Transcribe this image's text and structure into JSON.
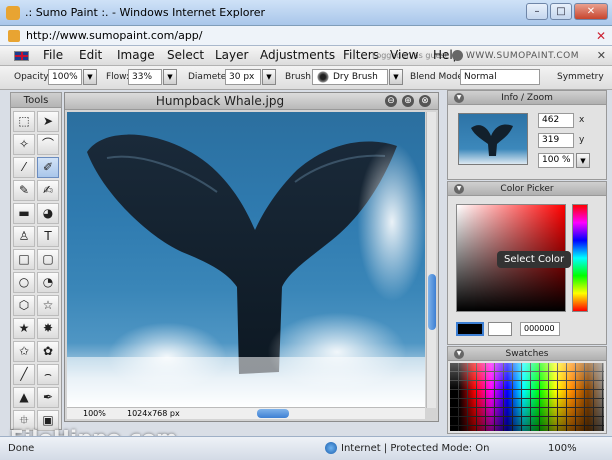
{
  "browser": {
    "title": ".: Sumo Paint       :. - Windows Internet Explorer",
    "address": "http://www.sumopaint.com/app/",
    "window_buttons": [
      "–",
      "□",
      "✕"
    ]
  },
  "menu": {
    "items": [
      "File",
      "Edit",
      "Image",
      "Select",
      "Layer",
      "Adjustments",
      "Filters",
      "View",
      "Help"
    ],
    "logout_text": "Logged in as guest",
    "logo_text": "WWW.SUMOPAINT.COM",
    "close": "✕"
  },
  "options": {
    "opacity_label": "Opacity:",
    "opacity_value": "100%",
    "flow_label": "Flow:",
    "flow_value": "33%",
    "diameter_label": "Diameter:",
    "diameter_value": "30 px",
    "brush_label": "Brush:",
    "brush_value": "Dry Brush",
    "blend_label": "Blend Mode:",
    "blend_value": "Normal",
    "symmetry_label": "Symmetry"
  },
  "tools": {
    "title": "Tools",
    "items": [
      {
        "name": "marquee-tool",
        "glyph": "⬚"
      },
      {
        "name": "move-tool",
        "glyph": "➤"
      },
      {
        "name": "magic-wand-tool",
        "glyph": "✧"
      },
      {
        "name": "lasso-tool",
        "glyph": "⌒"
      },
      {
        "name": "eyedropper-tool",
        "glyph": "⁄"
      },
      {
        "name": "brush-tool",
        "glyph": "✐"
      },
      {
        "name": "pencil-tool",
        "glyph": "✎"
      },
      {
        "name": "smudge-tool",
        "glyph": "✍"
      },
      {
        "name": "eraser-tool",
        "glyph": "▬"
      },
      {
        "name": "fill-tool",
        "glyph": "◕"
      },
      {
        "name": "clone-stamp-tool",
        "glyph": "♙"
      },
      {
        "name": "text-tool",
        "glyph": "T"
      },
      {
        "name": "rectangle-tool",
        "glyph": "□"
      },
      {
        "name": "rounded-rect-tool",
        "glyph": "▢"
      },
      {
        "name": "ellipse-tool",
        "glyph": "○"
      },
      {
        "name": "custom-shape-tool",
        "glyph": "◔"
      },
      {
        "name": "hexagon-tool",
        "glyph": "⬡"
      },
      {
        "name": "star-tool",
        "glyph": "☆"
      },
      {
        "name": "star-filled-tool",
        "glyph": "★"
      },
      {
        "name": "burst-tool",
        "glyph": "✸"
      },
      {
        "name": "star-outline-tool",
        "glyph": "✩"
      },
      {
        "name": "flower-tool",
        "glyph": "✿"
      },
      {
        "name": "line-tool",
        "glyph": "╱"
      },
      {
        "name": "curve-tool",
        "glyph": "⌢"
      },
      {
        "name": "drop-tool",
        "glyph": "▲"
      },
      {
        "name": "pen-tool",
        "glyph": "✒"
      },
      {
        "name": "crop-tool",
        "glyph": "⯐"
      },
      {
        "name": "transform-tool",
        "glyph": "▣"
      }
    ]
  },
  "document": {
    "title": "Humpback Whale.jpg",
    "zoom": "100%",
    "size": "1024x768 px",
    "buttons": [
      "⊖",
      "⊕",
      "⊗"
    ]
  },
  "info": {
    "title": "Info / Zoom",
    "x_value": "462",
    "x_label": "x",
    "y_value": "319",
    "y_label": "y",
    "zoom_value": "100 %"
  },
  "color_picker": {
    "title": "Color Picker",
    "tooltip": "Select Color",
    "hex": "000000",
    "foreground": "#000000",
    "background": "#ffffff"
  },
  "swatches": {
    "title": "Swatches"
  },
  "status": {
    "done": "Done",
    "zone": "Internet | Protected Mode: On",
    "zoom": "100%"
  },
  "watermark": "FileHippo.com",
  "colors": {
    "accent": "#3d7fd3",
    "chrome": "#a9c6ea"
  }
}
